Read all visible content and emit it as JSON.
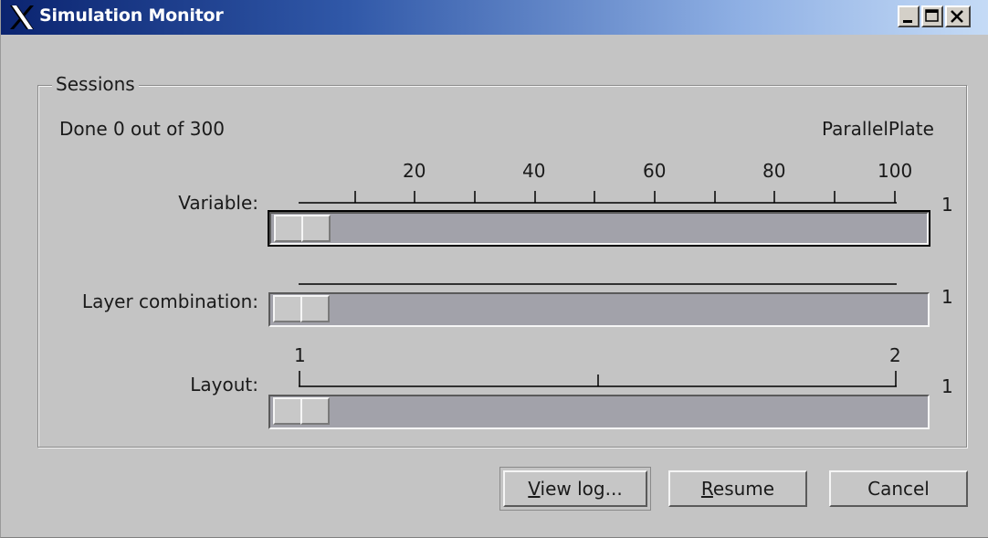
{
  "window": {
    "title": "Simulation Monitor"
  },
  "groupbox": {
    "label": "Sessions"
  },
  "status": {
    "done_text": "Done 0 out of 300",
    "model_name": "ParallelPlate"
  },
  "sliders": [
    {
      "label": "Variable:",
      "value": "1",
      "tick_labels": [
        "20",
        "40",
        "60",
        "80",
        "100"
      ]
    },
    {
      "label": "Layer combination:",
      "value": "1"
    },
    {
      "label": "Layout:",
      "value": "1",
      "min_label": "1",
      "max_label": "2"
    }
  ],
  "buttons": {
    "view_log": {
      "mnemonic": "V",
      "rest": "iew log..."
    },
    "resume": {
      "mnemonic": "R",
      "rest": "esume"
    },
    "cancel": {
      "label": "Cancel"
    }
  },
  "colors": {
    "title_gradient_start": "#0b2470",
    "title_gradient_end": "#c5dbf6",
    "window_bg": "#c4c4c4",
    "slider_track": "#a2a2aa"
  },
  "icons": {
    "app": "x11-logo-icon",
    "minimize": "minimize-icon",
    "maximize": "maximize-icon",
    "close": "close-icon"
  }
}
